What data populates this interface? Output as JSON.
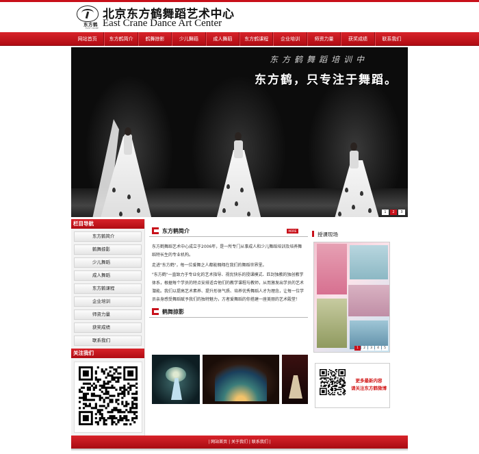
{
  "header": {
    "logo_text": "东方鹤",
    "logo_sub": "EAST CRANE",
    "title_cn": "北京东方鹤舞蹈艺术中心",
    "title_en": "East Crane Dance Art Center"
  },
  "nav": {
    "items": [
      "网站首页",
      "东方鹤简介",
      "鹤舞掠影",
      "少儿舞蹈",
      "成人舞蹈",
      "东方鹤课程",
      "企业培训",
      "师资力量",
      "获奖成绩",
      "联系我们"
    ]
  },
  "banner": {
    "subtitle": "东方鹤舞蹈培训中",
    "slogan": "东方鹤，只专注于舞蹈。",
    "pager": [
      "1",
      "2",
      "3"
    ],
    "active_page": 1
  },
  "sidebar": {
    "heading": "栏目导航",
    "items": [
      "东方鹤简介",
      "鹤舞掠影",
      "少儿舞蹈",
      "成人舞蹈",
      "东方鹤课程",
      "企业培训",
      "师资力量",
      "获奖成绩",
      "联系我们"
    ],
    "follow_heading": "关注我们"
  },
  "intro": {
    "title": "东方鹤简介",
    "more": "MORE",
    "paragraphs": [
      "东方鹤舞蹈艺术中心成立于2006年，是一所专门从事成人和少儿舞蹈培训及培养舞蹈特长生的专业机构。",
      "走进\"东方鹤\"，每一位爱舞之人都能翱翔在我们的舞蹈世界里。",
      "\"东方鹤\"一直致力于专业化的艺术指导、视优快乐的授课模式、匹封独教的独创教学体系，根据每个学员的特点安排适合他们的教学课程与教师，从而激发出学员的艺术潜能。我们以提高艺术素养、提升形体气质、培养优秀舞蹈人才为理念，让每一位学员亲身感受舞蹈赋予我们的独特魅力，方者爱舞蹈的你搭建一座美丽的艺术殿堂！"
    ]
  },
  "gallery": {
    "title": "鹤舞掠影"
  },
  "right": {
    "heading": "授课现场",
    "pager": [
      "1",
      "2",
      "3",
      "4",
      "5"
    ],
    "active_page": 1,
    "weibo_line1": "更多最新内容",
    "weibo_line2": "请关注东方鹤微博"
  },
  "footer": {
    "links": "| 网站首页 | 关于我们 | 联系我们 |"
  },
  "colors": {
    "brand_red": "#c8101a",
    "nav_red": "#d8232a",
    "weibo_text": "#d21a1a"
  }
}
